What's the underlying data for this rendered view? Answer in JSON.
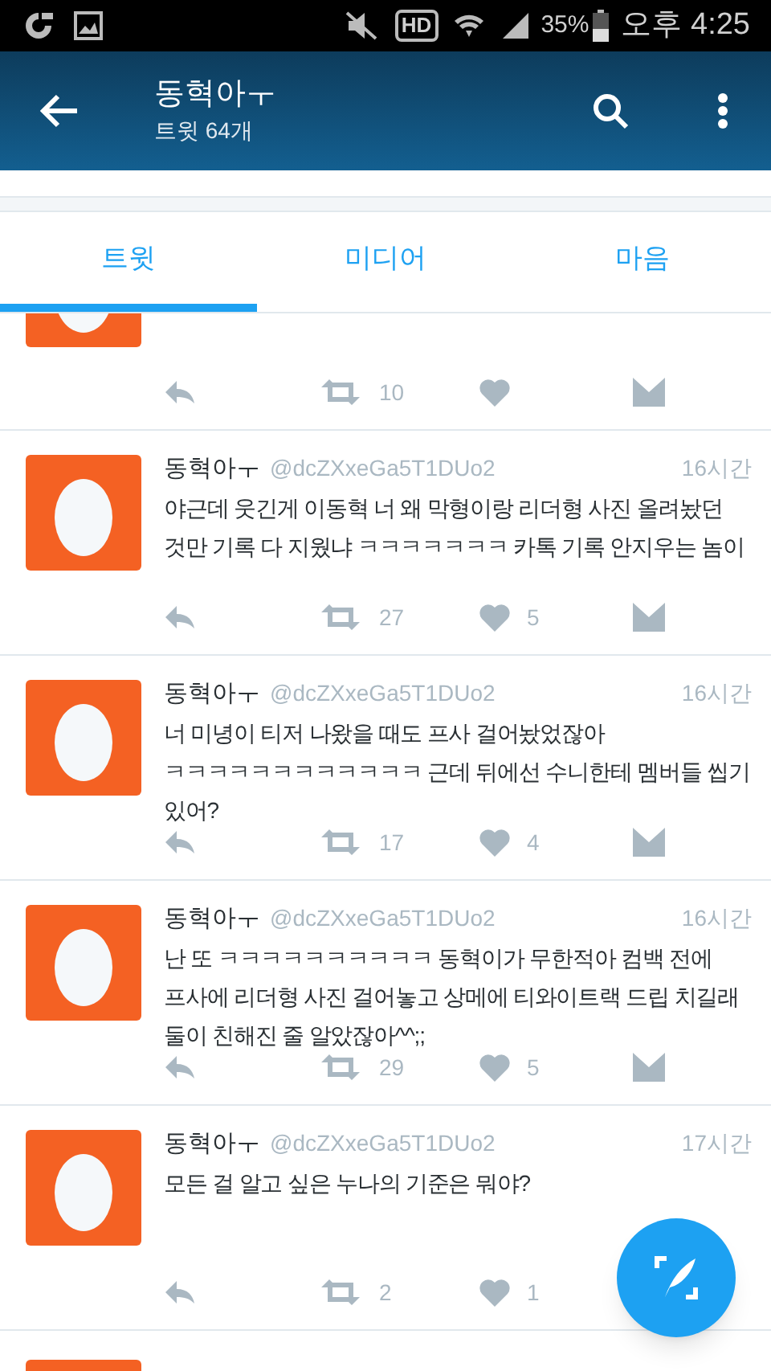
{
  "status_bar": {
    "hd": "HD",
    "battery": "35%",
    "time": "오후 4:25"
  },
  "app_bar": {
    "title": "동혁아ㅜ",
    "subtitle": "트윗 64개"
  },
  "tabs": [
    {
      "label": "트윗",
      "selected": true
    },
    {
      "label": "미디어",
      "selected": false
    },
    {
      "label": "마음",
      "selected": false
    }
  ],
  "tweets": [
    {
      "kind": "cut_top",
      "retweets": "10"
    },
    {
      "kind": "full",
      "name": "동혁아ㅜ",
      "handle": "@dcZXxeGa5T1DUo2",
      "time": "16시간",
      "text": "야근데 웃긴게 이동혁 너 왜 막형이랑 리더형 사진 올려놨던 것만 기록 다 지웠냐 ㅋㅋㅋㅋㅋㅋㅋ 카톡 기록 안지우는 놈이",
      "retweets": "27",
      "likes": "5"
    },
    {
      "kind": "full",
      "name": "동혁아ㅜ",
      "handle": "@dcZXxeGa5T1DUo2",
      "time": "16시간",
      "text": "너 미녕이 티저 나왔을 때도 프사 걸어놨었잖아 ㅋㅋㅋㅋㅋㅋㅋㅋㅋㅋㅋㅋ 근데 뒤에선 수니한테 멤버들 씹기 있어?",
      "retweets": "17",
      "likes": "4"
    },
    {
      "kind": "full",
      "name": "동혁아ㅜ",
      "handle": "@dcZXxeGa5T1DUo2",
      "time": "16시간",
      "text": "난 또 ㅋㅋㅋㅋㅋㅋㅋㅋㅋㅋ 동혁이가 무한적아 컴백 전에 프사에 리더형 사진 걸어놓고 상메에 티와이트랙 드립 치길래 둘이 친해진 줄 알았잖아^^;;",
      "retweets": "29",
      "likes": "5"
    },
    {
      "kind": "full",
      "name": "동혁아ㅜ",
      "handle": "@dcZXxeGa5T1DUo2",
      "time": "17시간",
      "text": "모든 걸 알고 싶은 누나의 기준은 뭐야?",
      "retweets": "2",
      "likes": "1",
      "dm_covered": true
    },
    {
      "kind": "cut_bottom"
    }
  ]
}
